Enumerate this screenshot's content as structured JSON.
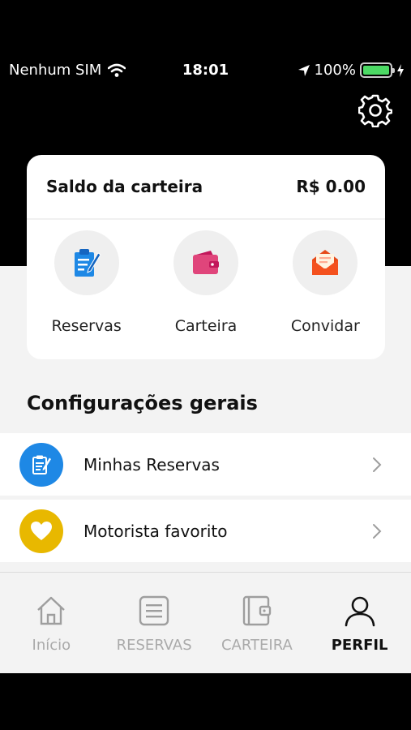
{
  "status_bar": {
    "carrier": "Nenhum SIM",
    "time": "18:01",
    "battery": "100%",
    "battery_level": 1.0,
    "icons": [
      "wifi-icon",
      "location-icon",
      "battery-icon",
      "charging-icon"
    ]
  },
  "header": {
    "settings_icon": "gear-icon"
  },
  "wallet": {
    "title": "Saldo da carteira",
    "balance": "R$ 0.00",
    "actions": [
      {
        "label": "Reservas",
        "icon": "clipboard-icon",
        "color": "#1e88e5"
      },
      {
        "label": "Carteira",
        "icon": "wallet-icon",
        "color": "#e0457b"
      },
      {
        "label": "Convidar",
        "icon": "envelope-icon",
        "color": "#f4511e"
      }
    ]
  },
  "settings": {
    "title": "Configurações gerais",
    "items": [
      {
        "label": "Minhas Reservas",
        "icon": "clipboard-icon",
        "color": "#1e88e5"
      },
      {
        "label": "Motorista favorito",
        "icon": "heart-icon",
        "color": "#e8b800"
      }
    ]
  },
  "tabs": [
    {
      "label": "Início",
      "icon": "home-icon",
      "active": false
    },
    {
      "label": "RESERVAS",
      "icon": "list-icon",
      "active": false
    },
    {
      "label": "CARTEIRA",
      "icon": "wallet-icon",
      "active": false
    },
    {
      "label": "PERFIL",
      "icon": "user-icon",
      "active": true
    }
  ]
}
